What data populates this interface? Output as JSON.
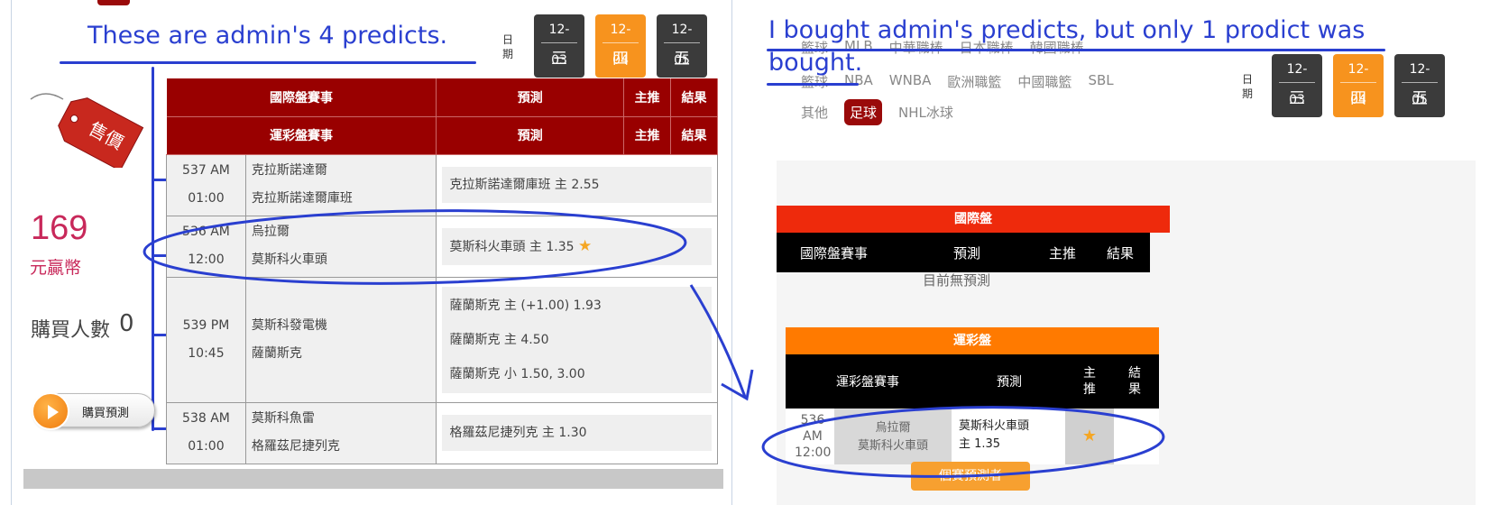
{
  "left": {
    "annotation": "These are admin's 4 predicts.",
    "date_label": "日\n期",
    "dates": [
      {
        "date": "12-03",
        "weekday": "三",
        "active": false
      },
      {
        "date": "12-04",
        "weekday": "四",
        "active": true
      },
      {
        "date": "12-05",
        "weekday": "五",
        "active": false
      }
    ],
    "tag_text": "售價",
    "score": "169",
    "score_unit": "元贏幣",
    "buyers_label": "購買人數",
    "buyers_count": "0",
    "buy_button": "購買預測",
    "table": {
      "header1": [
        "國際盤賽事",
        "預測",
        "主推",
        "結果"
      ],
      "header2": [
        "運彩盤賽事",
        "預測",
        "主推",
        "結果"
      ],
      "rows": [
        {
          "code": "537 AM",
          "time": "01:00",
          "team1": "克拉斯諾達爾",
          "team2": "克拉斯諾達爾庫班",
          "preds": [
            "克拉斯諾達爾庫班 主 2.55"
          ],
          "star": false
        },
        {
          "code": "536 AM",
          "time": "12:00",
          "team1": "烏拉爾",
          "team2": "莫斯科火車頭",
          "preds": [
            "莫斯科火車頭 主 1.35"
          ],
          "star": true
        },
        {
          "code": "539 PM",
          "time": "10:45",
          "team1": "莫斯科發電機",
          "team2": "薩蘭斯克",
          "preds": [
            "薩蘭斯克 主 (+1.00) 1.93",
            "薩蘭斯克 主 4.50",
            "薩蘭斯克 小 1.50, 3.00"
          ],
          "star": false
        },
        {
          "code": "538 AM",
          "time": "01:00",
          "team1": "莫斯科魚雷",
          "team2": "格羅茲尼捷列克",
          "preds": [
            "格羅茲尼捷列克 主 1.30"
          ],
          "star": false
        }
      ]
    }
  },
  "right": {
    "annotation_line1": "I bought admin's predicts, but only 1 prodict was",
    "annotation_line2": "bought.",
    "sports_row1": [
      "籃球",
      "MLB",
      "中華職棒",
      "日本職棒",
      "韓國職棒"
    ],
    "sports_row2": [
      "籃球",
      "NBA",
      "WNBA",
      "歐洲職籃",
      "中國職籃",
      "SBL"
    ],
    "sports_row3": [
      "其他",
      "足球",
      "NHL冰球"
    ],
    "active_sport": "足球",
    "date_label": "日\n期",
    "dates": [
      {
        "date": "12-03",
        "weekday": "三",
        "active": false
      },
      {
        "date": "12-04",
        "weekday": "四",
        "active": true
      },
      {
        "date": "12-05",
        "weekday": "五",
        "active": false
      }
    ],
    "intl_title": "國際盤",
    "intl_header": [
      "國際盤賽事",
      "預測",
      "主推",
      "結果"
    ],
    "intl_empty": "目前無預測",
    "sport_title": "運彩盤",
    "sport_header": [
      "運彩盤賽事",
      "預測",
      "主推",
      "結果"
    ],
    "sport_row": {
      "code": "536",
      "ampm": "AM",
      "time": "12:00",
      "team1": "烏拉爾",
      "team2": "莫斯科火車頭",
      "pred_line1": "莫斯科火車頭",
      "pred_line2": "主 1.35"
    },
    "bottom_button": "個賽預測者"
  },
  "colors": {
    "annotation": "#2a3fd0",
    "header_red": "#990000",
    "orange": "#f7931e",
    "score": "#c8285a"
  }
}
